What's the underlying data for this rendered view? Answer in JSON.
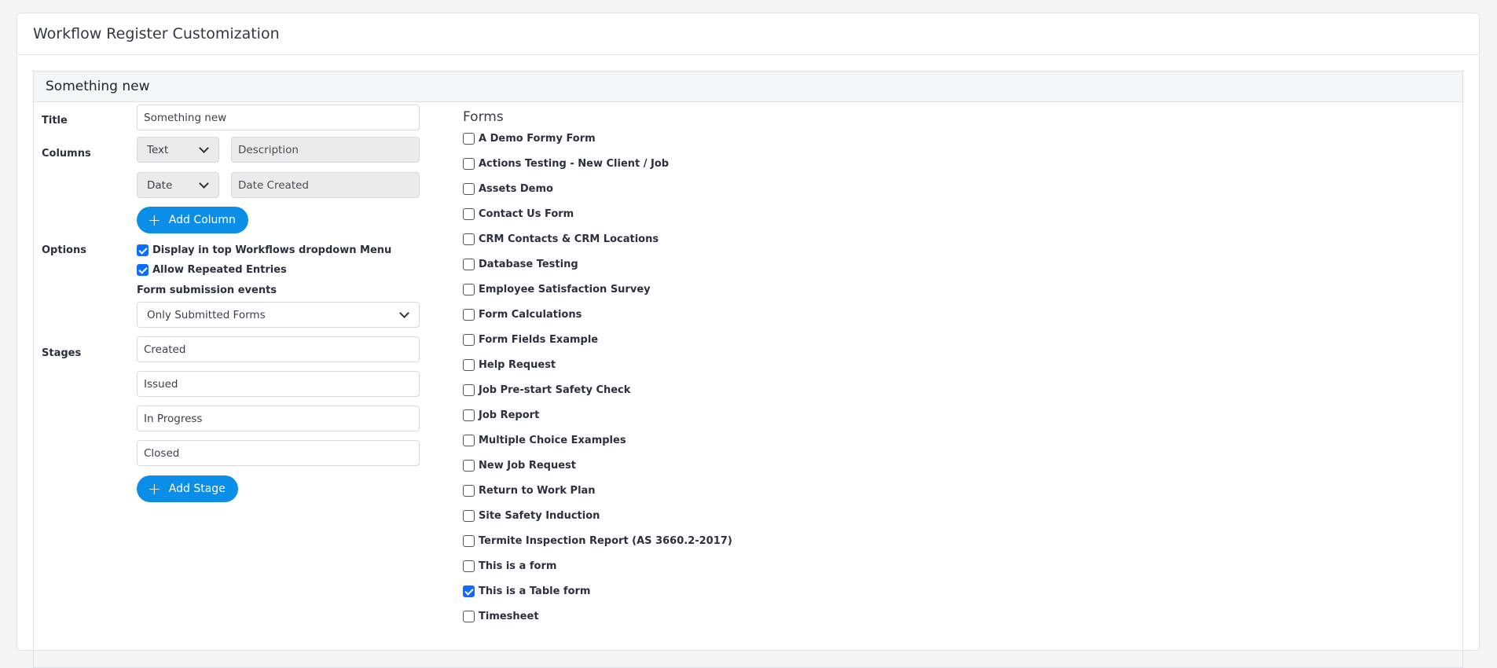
{
  "page": {
    "title": "Workflow Register Customization"
  },
  "register": {
    "name": "Something new",
    "title_label": "Title",
    "title_value": "Something new",
    "columns_label": "Columns",
    "columns": [
      {
        "type": "Text",
        "name": "Description"
      },
      {
        "type": "Date",
        "name": "Date Created"
      }
    ],
    "add_column_label": "Add Column",
    "options_label": "Options",
    "options": [
      {
        "label": "Display in top Workflows dropdown Menu",
        "checked": true
      },
      {
        "label": "Allow Repeated Entries",
        "checked": true
      }
    ],
    "submission_events_label": "Form submission events",
    "submission_events_value": "Only Submitted Forms",
    "stages_label": "Stages",
    "stages": [
      "Created",
      "Issued",
      "In Progress",
      "Closed"
    ],
    "add_stage_label": "Add Stage"
  },
  "forms": {
    "title": "Forms",
    "items": [
      {
        "label": "A Demo Formy Form",
        "checked": false
      },
      {
        "label": "Actions Testing - New Client / Job",
        "checked": false
      },
      {
        "label": "Assets Demo",
        "checked": false
      },
      {
        "label": "Contact Us Form",
        "checked": false
      },
      {
        "label": "CRM Contacts & CRM Locations",
        "checked": false
      },
      {
        "label": "Database Testing",
        "checked": false
      },
      {
        "label": "Employee Satisfaction Survey",
        "checked": false
      },
      {
        "label": "Form Calculations",
        "checked": false
      },
      {
        "label": "Form Fields Example",
        "checked": false
      },
      {
        "label": "Help Request",
        "checked": false
      },
      {
        "label": "Job Pre-start Safety Check",
        "checked": false
      },
      {
        "label": "Job Report",
        "checked": false
      },
      {
        "label": "Multiple Choice Examples",
        "checked": false
      },
      {
        "label": "New Job Request",
        "checked": false
      },
      {
        "label": "Return to Work Plan",
        "checked": false
      },
      {
        "label": "Site Safety Induction",
        "checked": false
      },
      {
        "label": "Termite Inspection Report (AS 3660.2-2017)",
        "checked": false
      },
      {
        "label": "This is a form",
        "checked": false
      },
      {
        "label": "This is a Table form",
        "checked": true
      },
      {
        "label": "Timesheet",
        "checked": false
      }
    ]
  },
  "colors": {
    "primary": "#0a8ee8",
    "checkbox_checked": "#0d6efd"
  }
}
